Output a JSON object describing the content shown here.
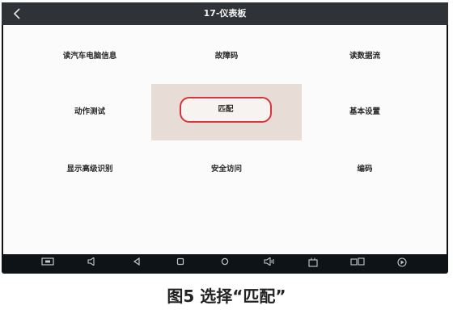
{
  "titlebar": {
    "title": "17-仪表板",
    "back_icon": "chevron-left-icon"
  },
  "menu": {
    "row1": [
      "读汽车电脑信息",
      "故障码",
      "读数据流"
    ],
    "row2": [
      "动作测试",
      "匹配",
      "基本设置"
    ],
    "row3": [
      "显示高级识别",
      "安全访问",
      "编码"
    ]
  },
  "selected_item": "匹配",
  "accent_color": "#d8323a",
  "navbar": {
    "icons": [
      "screenshot-icon",
      "volume-down-icon",
      "back-icon",
      "home-icon",
      "recent-apps-icon",
      "volume-up-icon",
      "vci-icon",
      "dual-screen-icon",
      "play-icon"
    ]
  },
  "caption": "图5 选择“匹配”"
}
